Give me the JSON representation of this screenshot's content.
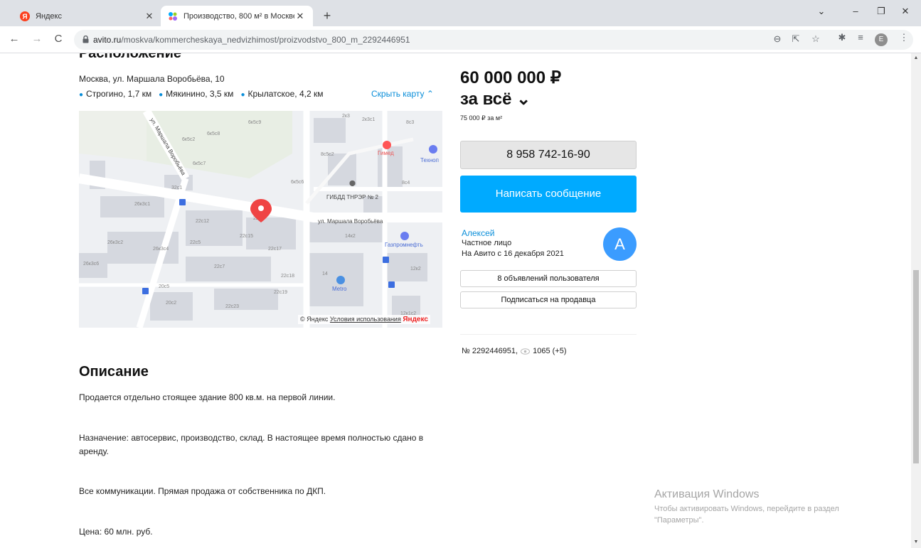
{
  "browser": {
    "tabs": [
      {
        "title": "Яндекс",
        "close": "✕"
      },
      {
        "title": "Производство, 800 м² в Москве",
        "close": "✕"
      }
    ],
    "new_tab": "+",
    "window_controls": {
      "chevron": "⌄",
      "minimize": "–",
      "restore": "❐",
      "close": "✕"
    },
    "nav": {
      "back": "←",
      "forward": "→",
      "reload": "C"
    },
    "url_host": "avito.ru",
    "url_path": "/moskva/kommercheskaya_nedvizhimost/proizvodstvo_800_m_2292446951",
    "profile_letter": "E"
  },
  "location": {
    "title": "Расположение",
    "address": "Москва, ул. Маршала Воробьёва, 10",
    "metro": [
      {
        "name": "Строгино, 1,7 км"
      },
      {
        "name": "Мякинино, 3,5 км"
      },
      {
        "name": "Крылатское, 4,2 км"
      }
    ],
    "hide_map": "Скрыть карту ⌃",
    "map_labels": {
      "street_top": "ул. Маршала Воробьёва",
      "street_bottom": "ул. Маршала Воробьёва",
      "gibdd": "ГИБДД ТНРЭР № 2",
      "gimed": "Гимед",
      "tech": "Техноп",
      "gazprom": "Газпромнефть",
      "metro_store": "Metro",
      "b1": "6к5с9",
      "b2": "6к5с8",
      "b3": "6к5с2",
      "b4": "6к5с7",
      "b5": "6к5с6",
      "b6": "32с1",
      "b7": "26к3с1",
      "b8": "22с12",
      "b9": "22с15",
      "b10": "22с17",
      "b11": "22с5",
      "b12": "26к3с2",
      "b13": "26к3с4",
      "b14": "26к3с6",
      "b15": "22с7",
      "b16": "22с18",
      "b17": "22с19",
      "b18": "20с5",
      "b19": "20с2",
      "b20": "22с23",
      "b21": "14к2",
      "b22": "14",
      "b23": "8с4",
      "b24": "8с3",
      "b25": "2к3",
      "b26": "2к3с1",
      "b27": "8с5с2",
      "b28": "12к2",
      "b29": "12к1с2",
      "b30": "22с3"
    },
    "zoom_in": "+",
    "zoom_out": "−",
    "copyright": "© Яндекс",
    "terms": "Условия использования",
    "yandex_logo": "Яндекс"
  },
  "description": {
    "title": "Описание",
    "paragraphs": [
      "Продается отдельно стоящее здание 800 кв.м. на первой линии.",
      "Назначение: автосервис, производство, склад. В настоящее время полностью сдано в аренду.",
      "Все коммуникации. Прямая продажа от собственника по ДКП.",
      "Цена: 60 млн. руб."
    ]
  },
  "offer": {
    "price": "60 000 000 ₽",
    "price_unit": "за всё ⌄",
    "price_per_m": "75 000 ₽ за м²",
    "phone": "8 958 742-16-90",
    "write_message": "Написать сообщение"
  },
  "seller": {
    "name": "Алексей",
    "type": "Частное лицо",
    "since": "На Авито с 16 декабря 2021",
    "avatar_letter": "A",
    "listings_button": "8 объявлений пользователя",
    "subscribe_button": "Подписаться на продавца"
  },
  "ad": {
    "number": "№ 2292446951,",
    "views": "1065 (+5)"
  },
  "windows_activation": {
    "title": "Активация Windows",
    "line1": "Чтобы активировать Windows, перейдите в раздел",
    "line2": "\"Параметры\"."
  },
  "colors": {
    "accent": "#00aaff",
    "link": "#0a8ed9",
    "map_pin": "#ef4444"
  }
}
